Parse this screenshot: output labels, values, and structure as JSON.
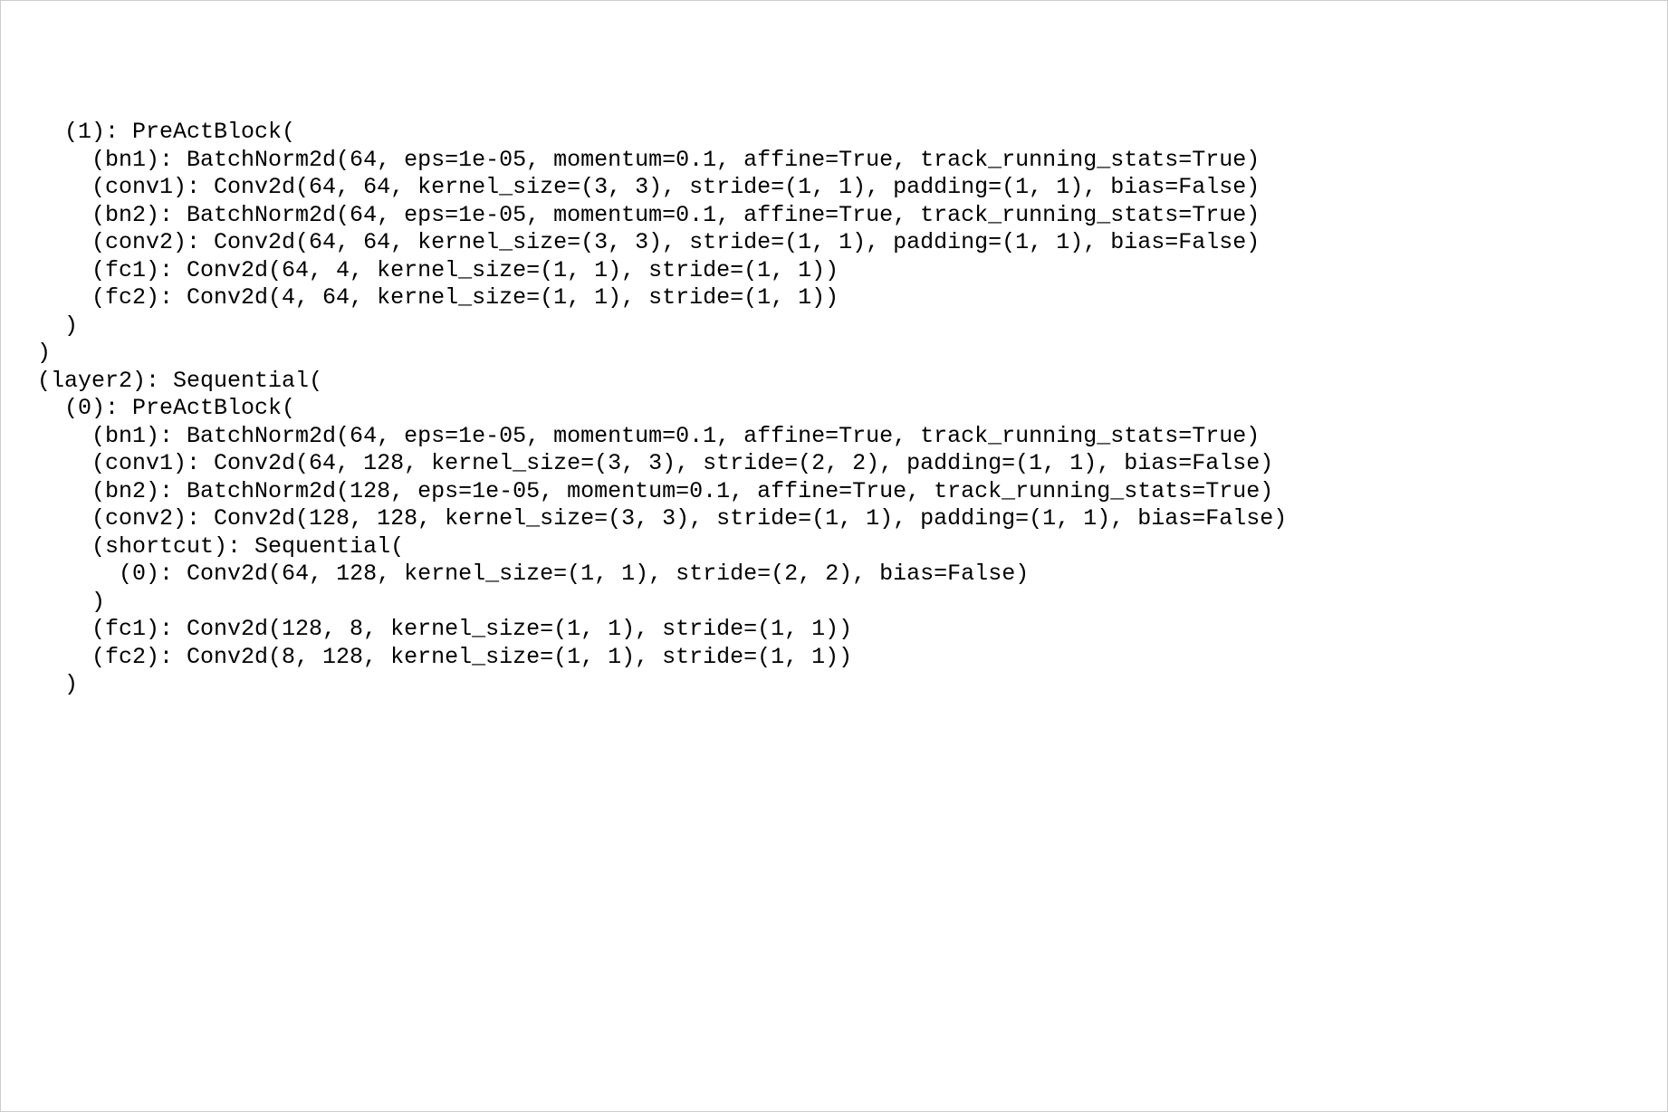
{
  "codeText": "    (1): PreActBlock(\n      (bn1): BatchNorm2d(64, eps=1e-05, momentum=0.1, affine=True, track_running_stats=True)\n      (conv1): Conv2d(64, 64, kernel_size=(3, 3), stride=(1, 1), padding=(1, 1), bias=False)\n      (bn2): BatchNorm2d(64, eps=1e-05, momentum=0.1, affine=True, track_running_stats=True)\n      (conv2): Conv2d(64, 64, kernel_size=(3, 3), stride=(1, 1), padding=(1, 1), bias=False)\n      (fc1): Conv2d(64, 4, kernel_size=(1, 1), stride=(1, 1))\n      (fc2): Conv2d(4, 64, kernel_size=(1, 1), stride=(1, 1))\n    )\n  )\n  (layer2): Sequential(\n    (0): PreActBlock(\n      (bn1): BatchNorm2d(64, eps=1e-05, momentum=0.1, affine=True, track_running_stats=True)\n      (conv1): Conv2d(64, 128, kernel_size=(3, 3), stride=(2, 2), padding=(1, 1), bias=False)\n      (bn2): BatchNorm2d(128, eps=1e-05, momentum=0.1, affine=True, track_running_stats=True)\n      (conv2): Conv2d(128, 128, kernel_size=(3, 3), stride=(1, 1), padding=(1, 1), bias=False)\n      (shortcut): Sequential(\n        (0): Conv2d(64, 128, kernel_size=(1, 1), stride=(2, 2), bias=False)\n      )\n      (fc1): Conv2d(128, 8, kernel_size=(1, 1), stride=(1, 1))\n      (fc2): Conv2d(8, 128, kernel_size=(1, 1), stride=(1, 1))\n    )"
}
